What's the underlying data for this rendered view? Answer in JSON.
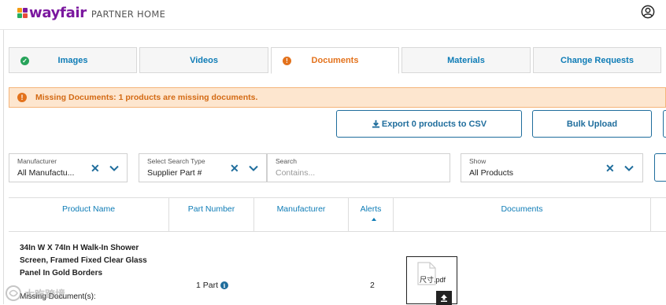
{
  "header": {
    "logo_text": "wayfair",
    "logo_sub": "PARTNER HOME",
    "logo_colors": [
      "#f39c12",
      "#7b189f",
      "#e74c3c",
      "#27ae60"
    ]
  },
  "tabs": [
    {
      "label": "Images",
      "status": "complete",
      "status_color": "#27a35a",
      "status_glyph": "✓"
    },
    {
      "label": "Videos",
      "status": "",
      "status_color": "",
      "status_glyph": ""
    },
    {
      "label": "Documents",
      "status": "warning",
      "status_color": "#e3721c",
      "status_glyph": "!"
    },
    {
      "label": "Materials",
      "status": "",
      "status_color": "",
      "status_glyph": ""
    },
    {
      "label": "Change Requests",
      "status": "",
      "status_color": "",
      "status_glyph": ""
    }
  ],
  "alert": {
    "icon": "exclamation-icon",
    "text": "Missing Documents: 1 products are missing documents."
  },
  "actions": {
    "export_label": "Export 0 products to CSV",
    "bulk_upload_label": "Bulk Upload"
  },
  "filters": {
    "manufacturer": {
      "label": "Manufacturer",
      "value": "All Manufactu..."
    },
    "search_type": {
      "label": "Select Search Type",
      "value": "Supplier Part #"
    },
    "search": {
      "label": "Search",
      "placeholder": "Contains..."
    },
    "show": {
      "label": "Show",
      "value": "All Products"
    }
  },
  "table": {
    "columns": [
      "Product Name",
      "Part Number",
      "Manufacturer",
      "Alerts",
      "Documents"
    ],
    "rows": [
      {
        "product_name": "34In W X 74In H Walk-In Shower Screen, Framed Fixed Clear Glass Panel In Gold Borders",
        "missing_label": "Missing Document(s):",
        "part_number": "1 Part",
        "manufacturer": "",
        "alerts": "2",
        "document": {
          "name": "尺寸.pdf"
        }
      }
    ]
  },
  "watermark": {
    "text": "大吃跨境"
  },
  "colors": {
    "link_blue": "#0e7cb6",
    "button_blue": "#1f6d9c",
    "warning_orange": "#e3721c",
    "alert_bg": "#fde6cf"
  }
}
